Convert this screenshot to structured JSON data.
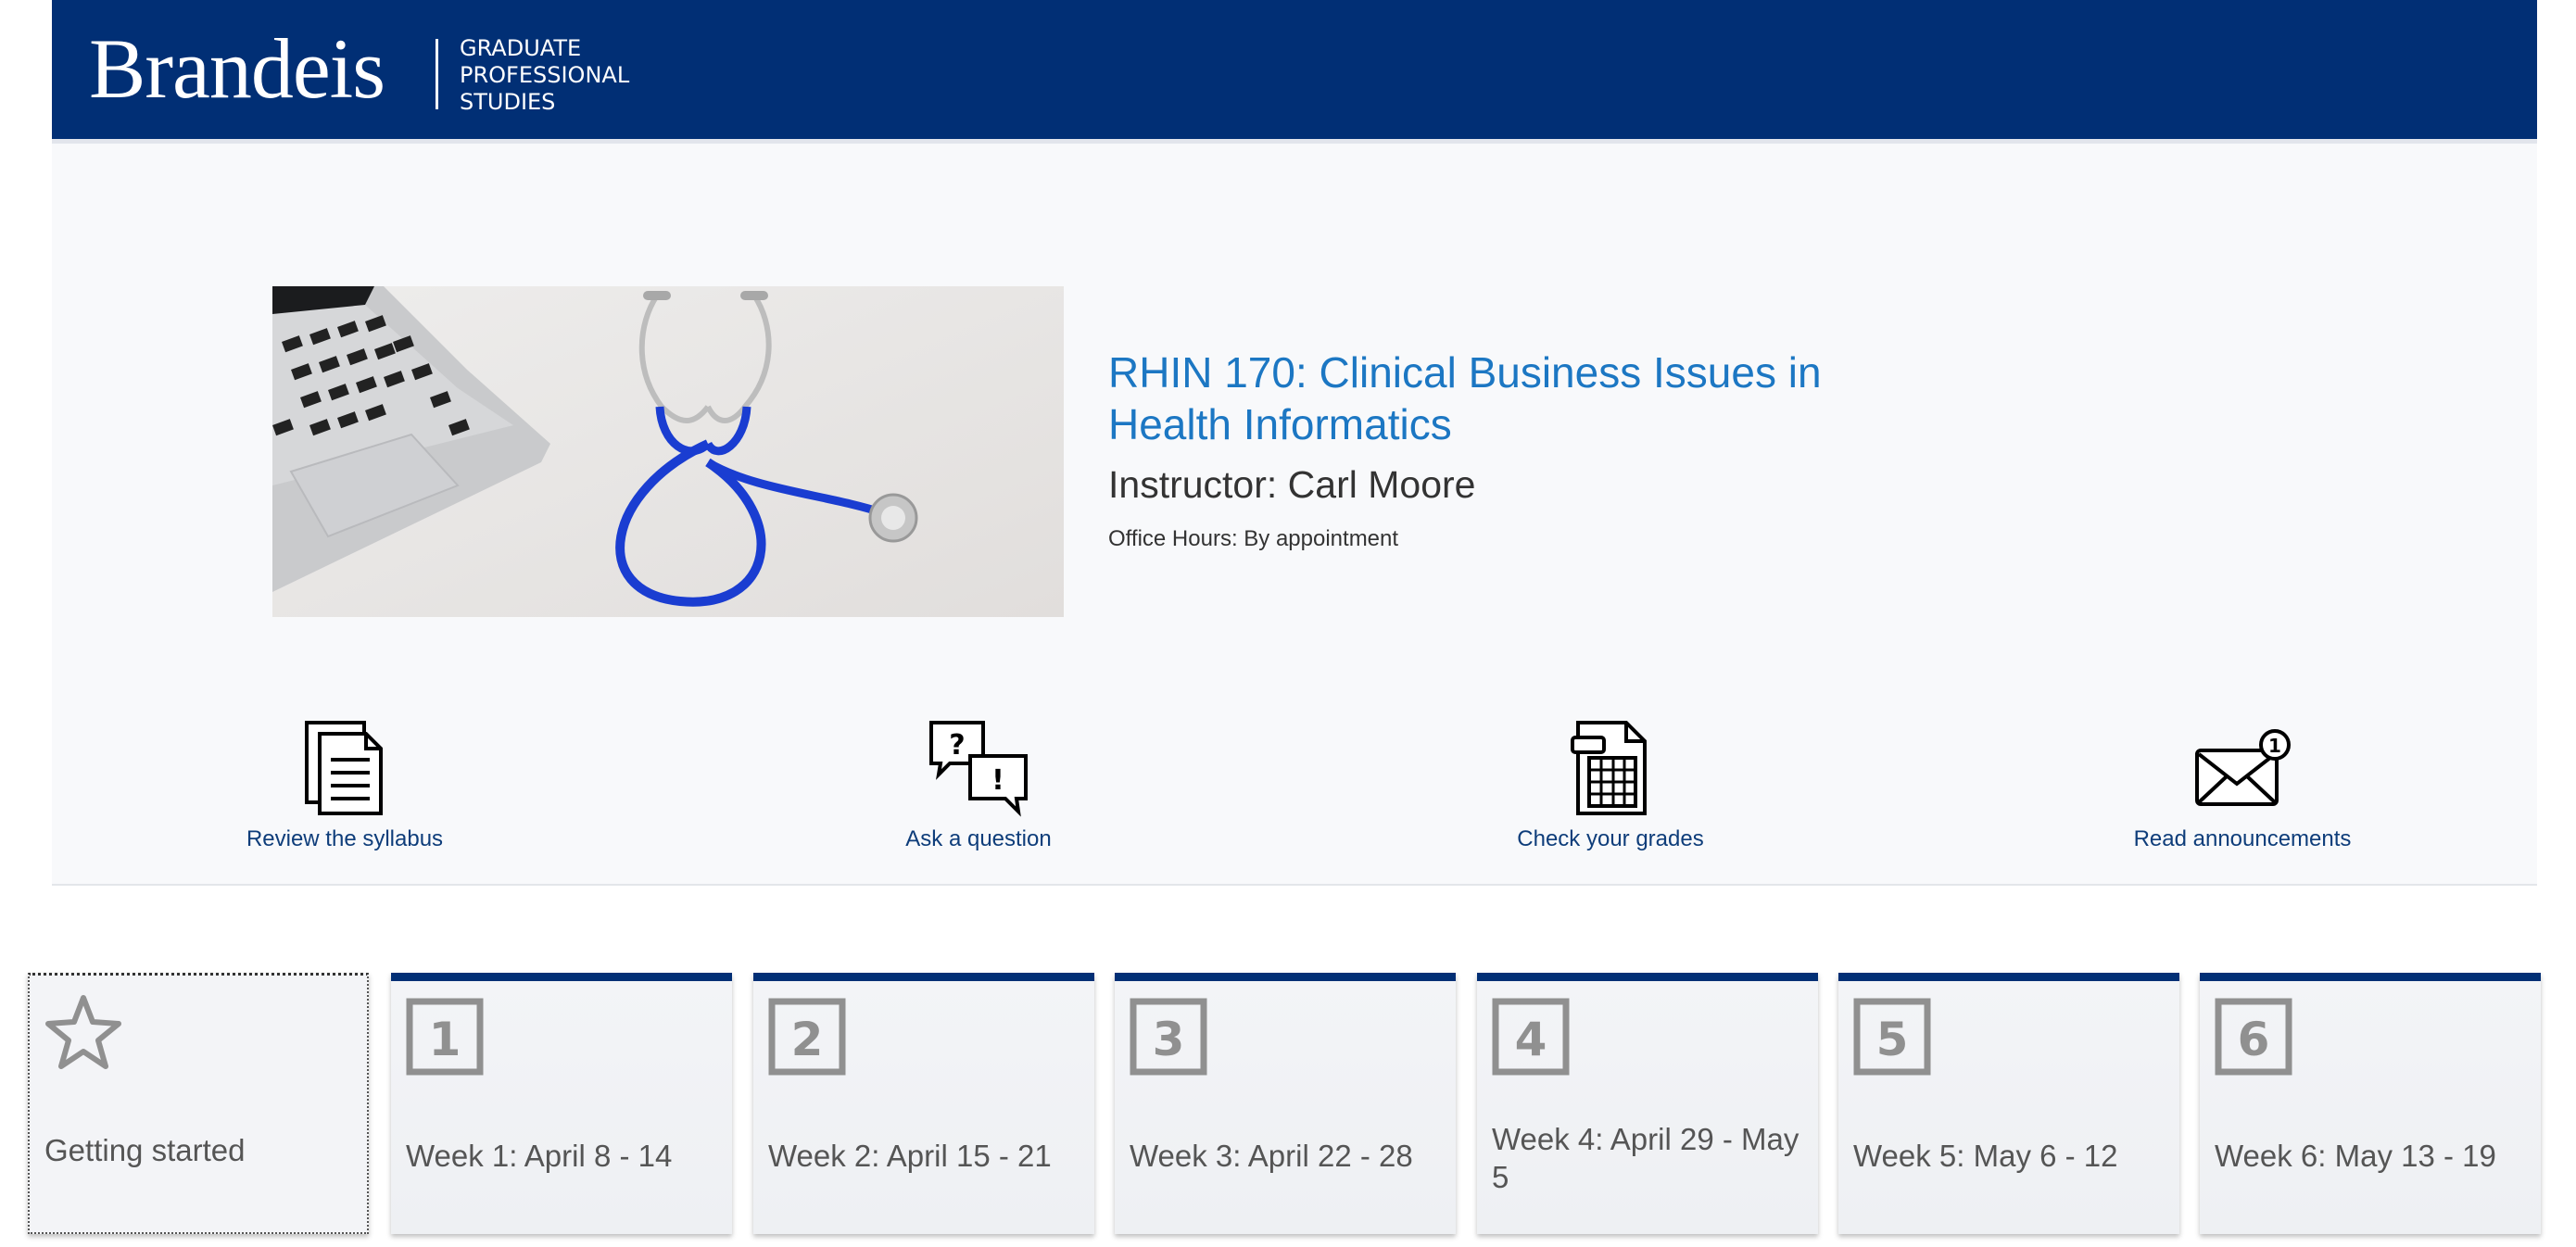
{
  "header": {
    "logo_text": "Brandeis",
    "logo_sub_line1": "GRADUATE",
    "logo_sub_line2": "PROFESSIONAL",
    "logo_sub_line3": "STUDIES",
    "brand_color": "#012f75"
  },
  "course": {
    "title": "RHIN 170: Clinical Business Issues in Health Informatics",
    "instructor": "Instructor: Carl Moore",
    "office_hours": "Office Hours: By appointment",
    "title_color": "#1c77c3"
  },
  "actions": [
    {
      "label": "Review the syllabus",
      "icon": "syllabus-document-icon"
    },
    {
      "label": "Ask a question",
      "icon": "question-chat-icon"
    },
    {
      "label": "Check your grades",
      "icon": "gradebook-spreadsheet-icon"
    },
    {
      "label": "Read announcements",
      "icon": "announcements-mail-icon",
      "badge": "1"
    }
  ],
  "modules": [
    {
      "label": "Getting started",
      "icon": "star-icon"
    },
    {
      "label": "Week 1: April 8 - 14",
      "number": "1"
    },
    {
      "label": "Week 2: April 15 - 21",
      "number": "2"
    },
    {
      "label": "Week 3: April 22 - 28",
      "number": "3"
    },
    {
      "label": "Week 4: April 29 - May 5",
      "number": "4"
    },
    {
      "label": "Week 5: May 6 - 12",
      "number": "5"
    },
    {
      "label": "Week 6: May 13 - 19",
      "number": "6"
    }
  ]
}
